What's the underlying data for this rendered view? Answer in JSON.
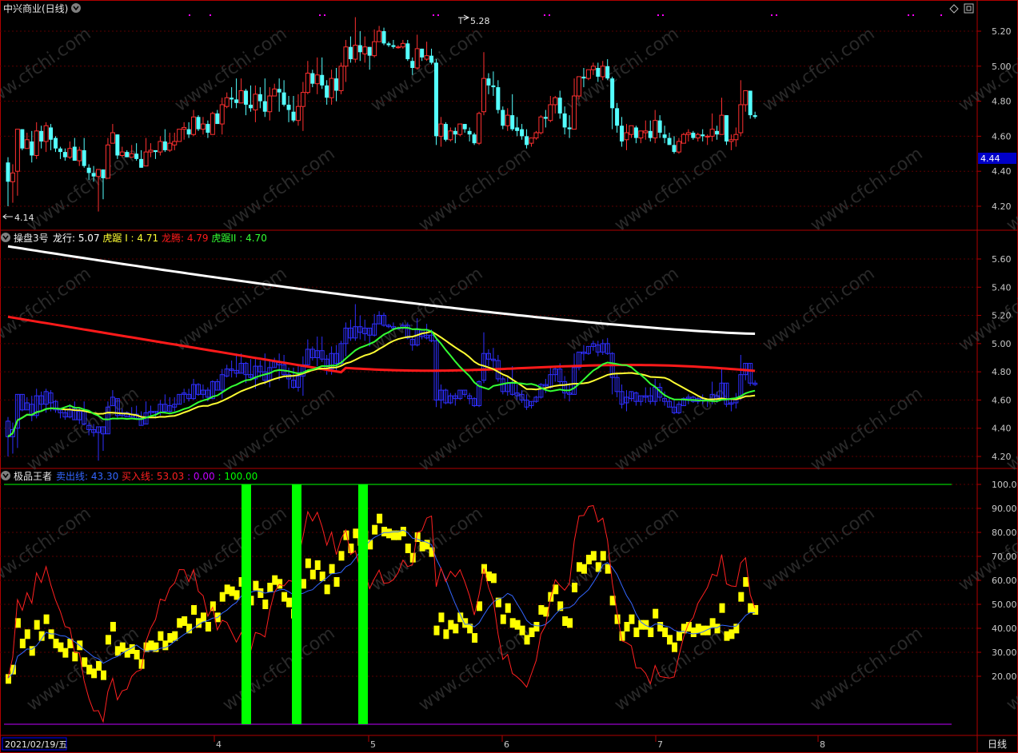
{
  "colors": {
    "background": "#000000",
    "frame": "#b00000",
    "grid": "#5a0000",
    "axis_text": "#c8c8c8",
    "up": "#ff3030",
    "down": "#54ffff",
    "ma_white": "#ffffff",
    "ma_red": "#ff1a1a",
    "ma_yellow": "#ffff33",
    "ma_green": "#33ff33",
    "box_blue": "#2f2fff",
    "sell_line": "#3366ff",
    "buy_line": "#ff2020",
    "yellow_block": "#ffff00",
    "green_bar": "#00ff00",
    "purple": "#c000ff",
    "marker": "#ff00ff"
  },
  "top_panel": {
    "title": "中兴商业(日线)",
    "price_badge": "4.44",
    "high_label": "5.28",
    "low_label": "4.14",
    "ticks": [
      "5.20",
      "5.00",
      "4.80",
      "4.60",
      "4.40",
      "4.20"
    ]
  },
  "mid_panel": {
    "name": "操盘3号",
    "legend": [
      {
        "label": "龙行: ",
        "value": "5.07",
        "color": "#ffffff"
      },
      {
        "label": "虎踞 I : ",
        "value": "4.71",
        "color": "#ffff33"
      },
      {
        "label": "龙腾: ",
        "value": "4.79",
        "color": "#ff1a1a"
      },
      {
        "label": "虎踞II : ",
        "value": "4.70",
        "color": "#33ff33"
      }
    ],
    "ticks": [
      "5.60",
      "5.40",
      "5.20",
      "5.00",
      "4.80",
      "4.60",
      "4.40",
      "4.20"
    ]
  },
  "bottom_panel": {
    "name": "极品王者",
    "legend": [
      {
        "label": "卖出线: ",
        "value": "43.30",
        "color": "#3366ff"
      },
      {
        "label": "买入线: ",
        "value": "53.03",
        "color": "#ff2020"
      },
      {
        "label": " : ",
        "value": "0.00",
        "color": "#c000ff"
      },
      {
        "label": " : ",
        "value": "100.00",
        "color": "#00ff00"
      }
    ],
    "ticks": [
      "100.0",
      "90.00",
      "80.00",
      "70.00",
      "60.00",
      "50.00",
      "40.00",
      "30.00",
      "20.00"
    ]
  },
  "date_axis": {
    "start_date": "2021/02/19/五",
    "months": [
      "4",
      "5",
      "6",
      "7",
      "8"
    ]
  },
  "period_label": "日线",
  "watermark": "www.cfchi.com",
  "chart_data": {
    "type": "candlestick",
    "period": "daily",
    "candles": [
      [
        4.45,
        4.34,
        4.48,
        4.2
      ],
      [
        4.34,
        4.39,
        4.44,
        4.22
      ],
      [
        4.4,
        4.64,
        4.64,
        4.26
      ],
      [
        4.64,
        4.53,
        4.64,
        4.52
      ],
      [
        4.53,
        4.58,
        4.62,
        4.53
      ],
      [
        4.57,
        4.49,
        4.63,
        4.45
      ],
      [
        4.49,
        4.63,
        4.68,
        4.47
      ],
      [
        4.63,
        4.57,
        4.66,
        4.53
      ],
      [
        4.57,
        4.66,
        4.68,
        4.51
      ],
      [
        4.65,
        4.58,
        4.67,
        4.52
      ],
      [
        4.59,
        4.53,
        4.6,
        4.51
      ],
      [
        4.53,
        4.51,
        4.54,
        4.47
      ],
      [
        4.51,
        4.48,
        4.53,
        4.46
      ],
      [
        4.48,
        4.53,
        4.57,
        4.47
      ],
      [
        4.54,
        4.46,
        4.59,
        4.46
      ],
      [
        4.46,
        4.52,
        4.54,
        4.43
      ],
      [
        4.52,
        4.43,
        4.59,
        4.42
      ],
      [
        4.42,
        4.39,
        4.44,
        4.35
      ],
      [
        4.39,
        4.37,
        4.43,
        4.34
      ],
      [
        4.37,
        4.41,
        4.41,
        4.17
      ],
      [
        4.41,
        4.36,
        4.41,
        4.24
      ],
      [
        4.36,
        4.55,
        4.59,
        4.36
      ],
      [
        4.56,
        4.62,
        4.67,
        4.56
      ],
      [
        4.61,
        4.49,
        4.61,
        4.47
      ],
      [
        4.49,
        4.51,
        4.54,
        4.48
      ],
      [
        4.51,
        4.48,
        4.52,
        4.48
      ],
      [
        4.48,
        4.5,
        4.55,
        4.48
      ],
      [
        4.5,
        4.47,
        4.56,
        4.46
      ],
      [
        4.47,
        4.42,
        4.52,
        4.42
      ],
      [
        4.43,
        4.51,
        4.59,
        4.43
      ],
      [
        4.51,
        4.52,
        4.56,
        4.48
      ],
      [
        4.52,
        4.51,
        4.52,
        4.47
      ],
      [
        4.51,
        4.57,
        4.6,
        4.49
      ],
      [
        4.57,
        4.52,
        4.64,
        4.51
      ],
      [
        4.52,
        4.56,
        4.62,
        4.51
      ],
      [
        4.55,
        4.57,
        4.62,
        4.52
      ],
      [
        4.57,
        4.64,
        4.64,
        4.57
      ],
      [
        4.64,
        4.65,
        4.68,
        4.58
      ],
      [
        4.64,
        4.61,
        4.68,
        4.59
      ],
      [
        4.61,
        4.71,
        4.75,
        4.6
      ],
      [
        4.71,
        4.64,
        4.72,
        4.63
      ],
      [
        4.64,
        4.67,
        4.71,
        4.61
      ],
      [
        4.67,
        4.62,
        4.69,
        4.59
      ],
      [
        4.61,
        4.73,
        4.74,
        4.61
      ],
      [
        4.73,
        4.67,
        4.75,
        4.67
      ],
      [
        4.67,
        4.78,
        4.82,
        4.61
      ],
      [
        4.77,
        4.82,
        4.85,
        4.76
      ],
      [
        4.82,
        4.81,
        4.88,
        4.76
      ],
      [
        4.81,
        4.79,
        4.93,
        4.76
      ],
      [
        4.79,
        4.86,
        4.93,
        4.79
      ],
      [
        4.86,
        4.78,
        4.87,
        4.72
      ],
      [
        4.78,
        4.76,
        4.89,
        4.74
      ],
      [
        4.75,
        4.84,
        4.89,
        4.68
      ],
      [
        4.84,
        4.8,
        4.88,
        4.76
      ],
      [
        4.8,
        4.74,
        4.93,
        4.71
      ],
      [
        4.74,
        4.83,
        4.88,
        4.69
      ],
      [
        4.83,
        4.87,
        4.9,
        4.83
      ],
      [
        4.87,
        4.85,
        4.93,
        4.74
      ],
      [
        4.85,
        4.78,
        4.92,
        4.77
      ],
      [
        4.78,
        4.75,
        4.83,
        4.68
      ],
      [
        4.74,
        4.69,
        4.83,
        4.68
      ],
      [
        4.69,
        4.77,
        4.84,
        4.66
      ],
      [
        4.77,
        4.85,
        4.91,
        4.63
      ],
      [
        4.85,
        4.96,
        5.03,
        4.84
      ],
      [
        4.96,
        4.9,
        4.98,
        4.88
      ],
      [
        4.9,
        4.95,
        5.05,
        4.84
      ],
      [
        4.95,
        4.89,
        5.05,
        4.87
      ],
      [
        4.89,
        4.82,
        4.92,
        4.78
      ],
      [
        4.82,
        4.93,
        4.98,
        4.78
      ],
      [
        4.93,
        4.86,
        4.99,
        4.8
      ],
      [
        4.86,
        5.0,
        5.02,
        4.84
      ],
      [
        5.0,
        5.11,
        5.15,
        4.91
      ],
      [
        5.11,
        5.04,
        5.17,
        5.02
      ],
      [
        5.04,
        5.12,
        5.28,
        5.02
      ],
      [
        5.12,
        5.08,
        5.2,
        5.03
      ],
      [
        5.07,
        5.11,
        5.17,
        5.02
      ],
      [
        5.11,
        5.06,
        5.11,
        4.98
      ],
      [
        5.06,
        5.14,
        5.21,
        5.05
      ],
      [
        5.14,
        5.2,
        5.23,
        5.14
      ],
      [
        5.2,
        5.13,
        5.22,
        5.12
      ],
      [
        5.13,
        5.12,
        5.14,
        5.11
      ],
      [
        5.12,
        5.11,
        5.15,
        5.1
      ],
      [
        5.11,
        5.11,
        5.12,
        5.1
      ],
      [
        5.11,
        5.13,
        5.15,
        5.1
      ],
      [
        5.13,
        5.04,
        5.15,
        5.03
      ],
      [
        5.03,
        4.99,
        5.05,
        4.95
      ],
      [
        4.99,
        5.1,
        5.18,
        4.98
      ],
      [
        5.1,
        5.05,
        5.1,
        5.03
      ],
      [
        5.04,
        5.06,
        5.14,
        5.03
      ],
      [
        5.06,
        5.02,
        5.1,
        5.01
      ],
      [
        5.02,
        4.6,
        5.04,
        4.55
      ],
      [
        4.6,
        4.67,
        4.71,
        4.54
      ],
      [
        4.67,
        4.58,
        4.68,
        4.57
      ],
      [
        4.58,
        4.63,
        4.65,
        4.57
      ],
      [
        4.63,
        4.61,
        4.65,
        4.56
      ],
      [
        4.61,
        4.67,
        4.67,
        4.6
      ],
      [
        4.67,
        4.64,
        4.67,
        4.62
      ],
      [
        4.63,
        4.61,
        4.65,
        4.57
      ],
      [
        4.61,
        4.56,
        4.62,
        4.55
      ],
      [
        4.56,
        4.73,
        4.74,
        4.55
      ],
      [
        4.74,
        4.93,
        5.08,
        4.72
      ],
      [
        4.93,
        4.89,
        4.96,
        4.84
      ],
      [
        4.89,
        4.88,
        4.97,
        4.83
      ],
      [
        4.88,
        4.75,
        4.92,
        4.73
      ],
      [
        4.75,
        4.66,
        4.77,
        4.64
      ],
      [
        4.66,
        4.72,
        4.76,
        4.63
      ],
      [
        4.72,
        4.64,
        4.84,
        4.63
      ],
      [
        4.65,
        4.63,
        4.71,
        4.6
      ],
      [
        4.64,
        4.6,
        4.67,
        4.58
      ],
      [
        4.6,
        4.55,
        4.64,
        4.53
      ],
      [
        4.56,
        4.59,
        4.59,
        4.54
      ],
      [
        4.59,
        4.62,
        4.63,
        4.58
      ],
      [
        4.62,
        4.71,
        4.72,
        4.61
      ],
      [
        4.71,
        4.7,
        4.75,
        4.65
      ],
      [
        4.69,
        4.78,
        4.83,
        4.68
      ],
      [
        4.78,
        4.82,
        4.83,
        4.73
      ],
      [
        4.82,
        4.73,
        4.86,
        4.7
      ],
      [
        4.73,
        4.65,
        4.77,
        4.61
      ],
      [
        4.65,
        4.64,
        4.72,
        4.59
      ],
      [
        4.64,
        4.83,
        4.93,
        4.64
      ],
      [
        4.83,
        4.94,
        4.94,
        4.81
      ],
      [
        4.94,
        4.93,
        4.99,
        4.88
      ],
      [
        4.93,
        4.98,
        4.98,
        4.92
      ],
      [
        4.98,
        5.0,
        5.02,
        4.95
      ],
      [
        4.99,
        4.94,
        5.02,
        4.91
      ],
      [
        4.94,
        5.0,
        5.03,
        4.92
      ],
      [
        5.0,
        4.93,
        5.04,
        4.92
      ],
      [
        4.93,
        4.76,
        4.94,
        4.64
      ],
      [
        4.76,
        4.66,
        4.79,
        4.62
      ],
      [
        4.66,
        4.57,
        4.71,
        4.54
      ],
      [
        4.58,
        4.62,
        4.67,
        4.52
      ],
      [
        4.61,
        4.66,
        4.66,
        4.59
      ],
      [
        4.65,
        4.59,
        4.66,
        4.56
      ],
      [
        4.59,
        4.63,
        4.63,
        4.56
      ],
      [
        4.62,
        4.63,
        4.69,
        4.58
      ],
      [
        4.63,
        4.59,
        4.69,
        4.57
      ],
      [
        4.59,
        4.69,
        4.75,
        4.56
      ],
      [
        4.69,
        4.62,
        4.72,
        4.59
      ],
      [
        4.61,
        4.59,
        4.66,
        4.56
      ],
      [
        4.59,
        4.55,
        4.62,
        4.55
      ],
      [
        4.55,
        4.51,
        4.6,
        4.5
      ],
      [
        4.51,
        4.57,
        4.59,
        4.5
      ],
      [
        4.56,
        4.61,
        4.62,
        4.56
      ],
      [
        4.61,
        4.62,
        4.64,
        4.57
      ],
      [
        4.62,
        4.59,
        4.63,
        4.58
      ],
      [
        4.59,
        4.61,
        4.62,
        4.57
      ],
      [
        4.61,
        4.6,
        4.64,
        4.57
      ],
      [
        4.6,
        4.6,
        4.61,
        4.55
      ],
      [
        4.6,
        4.64,
        4.73,
        4.57
      ],
      [
        4.63,
        4.61,
        4.66,
        4.58
      ],
      [
        4.61,
        4.72,
        4.82,
        4.61
      ],
      [
        4.72,
        4.57,
        4.72,
        4.55
      ],
      [
        4.57,
        4.58,
        4.61,
        4.52
      ],
      [
        4.58,
        4.61,
        4.65,
        4.54
      ],
      [
        4.62,
        4.78,
        4.92,
        4.6
      ],
      [
        4.78,
        4.86,
        4.86,
        4.74
      ],
      [
        4.86,
        4.72,
        4.86,
        4.7
      ],
      [
        4.72,
        4.71,
        4.74,
        4.7
      ]
    ],
    "moving_averages": [
      {
        "name": "龙行",
        "last_value": 5.07,
        "start_value": 5.69
      },
      {
        "name": "龙腾",
        "last_value": 4.79,
        "start_value": 5.19
      },
      {
        "name": "虎踞 I",
        "last_value": 4.71
      },
      {
        "name": "虎踞II",
        "last_value": 4.7
      }
    ],
    "indicator": {
      "name": "极品王者",
      "sell_line_last": 43.3,
      "buy_line_last": 53.03,
      "bounds": [
        0,
        100
      ],
      "buy_signal_count": 3
    }
  }
}
